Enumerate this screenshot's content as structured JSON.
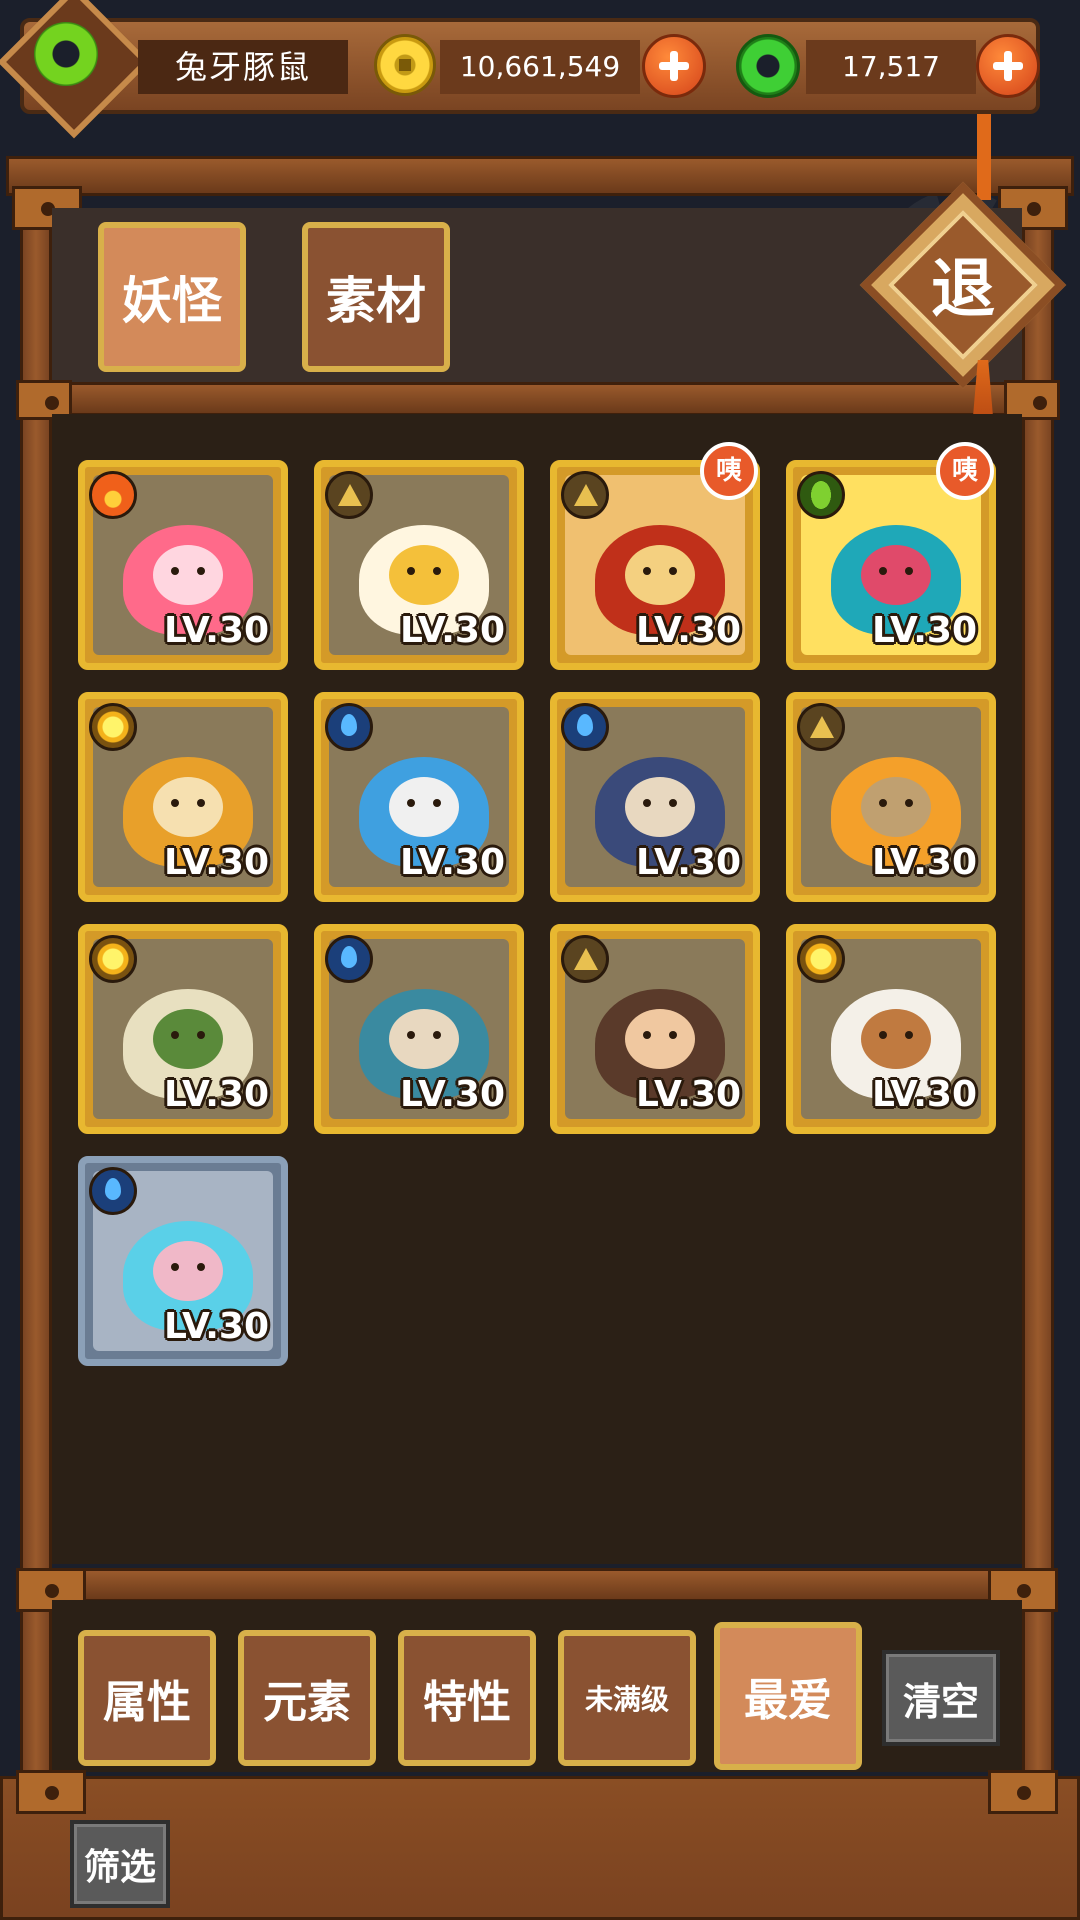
{
  "player": {
    "name": "兔牙豚鼠"
  },
  "currency": {
    "coins": "10,661,549",
    "jade": "17,517"
  },
  "tabs": [
    {
      "label": "妖怪",
      "active": true
    },
    {
      "label": "素材",
      "active": false
    }
  ],
  "exit_label": "退",
  "cards": [
    {
      "element": "fire-icon",
      "level": "LV.30",
      "badge": null,
      "frame": "gold",
      "art": "macaron-monster"
    },
    {
      "element": "earth-icon",
      "level": "LV.30",
      "badge": null,
      "frame": "gold",
      "art": "egg-bear"
    },
    {
      "element": "earth-icon",
      "level": "LV.30",
      "badge": "咦",
      "frame": "gold",
      "art": "crowned-monk"
    },
    {
      "element": "leaf-icon",
      "level": "LV.30",
      "badge": "咦",
      "frame": "gold",
      "art": "blue-lion"
    },
    {
      "element": "sun-icon",
      "level": "LV.30",
      "badge": null,
      "frame": "gold",
      "art": "golden-buddha"
    },
    {
      "element": "water-icon",
      "level": "LV.30",
      "badge": null,
      "frame": "gold",
      "art": "water-spirit"
    },
    {
      "element": "water-icon",
      "level": "LV.30",
      "badge": null,
      "frame": "gold",
      "art": "blue-haired-girl"
    },
    {
      "element": "earth-icon",
      "level": "LV.30",
      "badge": null,
      "frame": "gold",
      "art": "hooded-orange-hair"
    },
    {
      "element": "sun-icon",
      "level": "LV.30",
      "badge": null,
      "frame": "gold",
      "art": "taoist-sage"
    },
    {
      "element": "water-icon",
      "level": "LV.30",
      "badge": null,
      "frame": "gold",
      "art": "bearded-scholar"
    },
    {
      "element": "earth-icon",
      "level": "LV.30",
      "badge": null,
      "frame": "gold",
      "art": "bun-hair-girl"
    },
    {
      "element": "sun-icon",
      "level": "LV.30",
      "badge": null,
      "frame": "gold",
      "art": "white-chef"
    },
    {
      "element": "water-icon",
      "level": "LV.30",
      "badge": null,
      "frame": "silver",
      "art": "cyan-mermaid"
    }
  ],
  "filters": [
    {
      "label": "属性",
      "active": false
    },
    {
      "label": "元素",
      "active": false
    },
    {
      "label": "特性",
      "active": false
    },
    {
      "label": "未满级",
      "active": false
    },
    {
      "label": "最爱",
      "active": true
    }
  ],
  "clear_label": "清空",
  "filter_toggle_label": "筛选"
}
